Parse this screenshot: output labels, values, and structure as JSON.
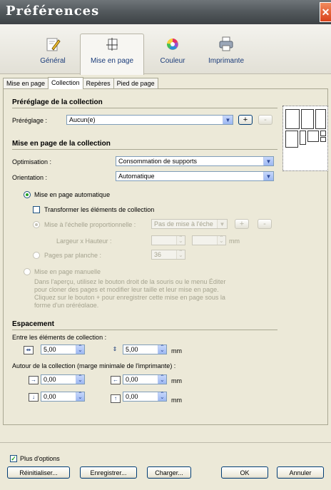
{
  "window": {
    "title": "Préférences",
    "close": "✕"
  },
  "toolbar": {
    "items": [
      {
        "label": "Général",
        "icon": "pencil-page-icon"
      },
      {
        "label": "Mise en page",
        "icon": "crop-layout-icon"
      },
      {
        "label": "Couleur",
        "icon": "color-wheel-icon"
      },
      {
        "label": "Imprimante",
        "icon": "printer-icon"
      }
    ],
    "active": "Mise en page"
  },
  "tabs": [
    "Mise en page",
    "Collection",
    "Repères",
    "Pied de page"
  ],
  "active_tab": "Collection",
  "preset_section": {
    "title": "Préréglage de la collection",
    "label": "Préréglage :",
    "value": "Aucun(e)",
    "add": "+",
    "remove": "-"
  },
  "layout_section": {
    "title": "Mise en page de la collection",
    "optimisation_label": "Optimisation :",
    "optimisation_value": "Consommation de supports",
    "orientation_label": "Orientation :",
    "orientation_value": "Automatique",
    "auto_layout": "Mise en page automatique",
    "transform": "Transformer les éléments de collection",
    "proportional": "Mise à l'échelle proportionnelle :",
    "proportional_value": "Pas de mise à l'éche",
    "add": "+",
    "remove": "-",
    "width_height": "Largeur x Hauteur :",
    "mm": "mm",
    "pages_per_sheet": "Pages par planche :",
    "pages_per_sheet_value": "36",
    "manual_layout": "Mise en page manuelle",
    "manual_desc_1": "Dans l'aperçu, utilisez le bouton droit de la souris ou le menu Éditer",
    "manual_desc_2": "pour cloner des pages et modifier leur taille et leur mise en page.",
    "manual_desc_3": "Cliquez sur le bouton + pour enregistrer cette mise en page sous la",
    "manual_desc_4": "forme d'un préréglage."
  },
  "spacing_section": {
    "title": "Espacement",
    "between_label": "Entre les éléments de collection :",
    "between_h": "5,00",
    "between_v": "5,00",
    "mm": "mm",
    "around_label": "Autour de la collection (marge minimale de l'imprimante) :",
    "left": "0,00",
    "right": "0,00",
    "top": "0,00",
    "bottom": "0,00"
  },
  "footer": {
    "more_options": "Plus d'options",
    "reset": "Réinitialiser...",
    "save": "Enregistrer...",
    "load": "Charger...",
    "ok": "OK",
    "cancel": "Annuler"
  },
  "colors": {
    "title_bar": "#52585c",
    "close": "#d9421b",
    "accent": "#1b3c7a"
  }
}
